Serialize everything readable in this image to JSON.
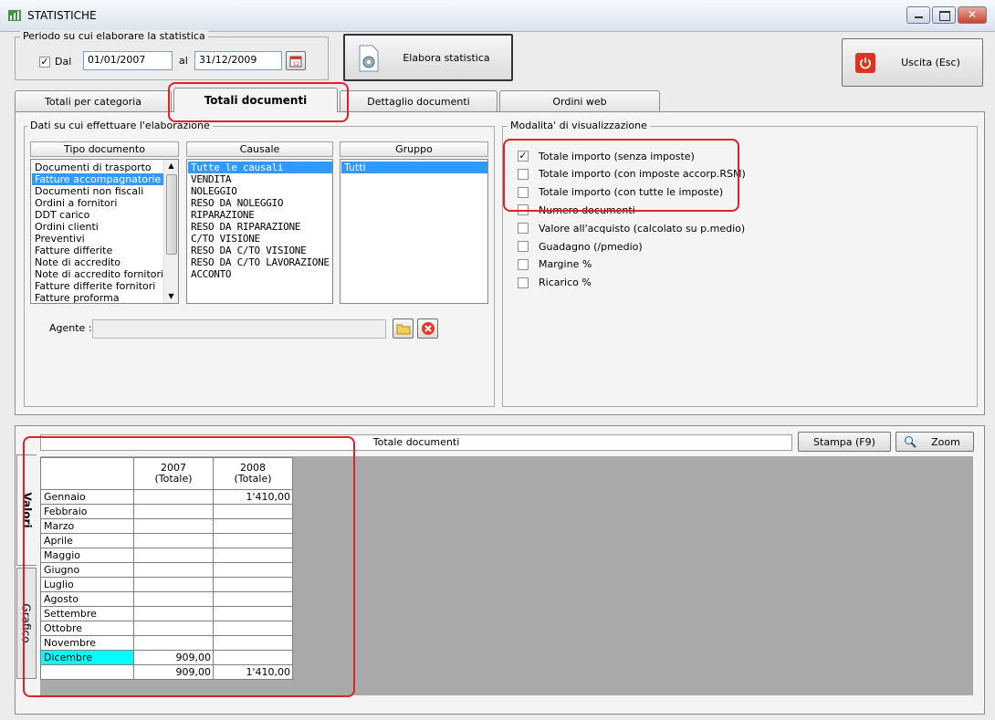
{
  "window": {
    "title": "STATISTICHE"
  },
  "period": {
    "group_label": "Periodo su cui elaborare la statistica",
    "from_label": "Dal",
    "from_checked": true,
    "from_value": "01/01/2007",
    "to_label": "al",
    "to_value": "31/12/2009"
  },
  "toolbar": {
    "process_label": "Elabora statistica",
    "exit_label": "Uscita (Esc)"
  },
  "tabs": [
    {
      "label": "Totali per categoria"
    },
    {
      "label": "Totali documenti"
    },
    {
      "label": "Dettaglio documenti"
    },
    {
      "label": "Ordini web"
    }
  ],
  "data_group": {
    "label": "Dati su cui effettuare l'elaborazione",
    "tipo_header": "Tipo documento",
    "tipo_items": [
      "Documenti di trasporto",
      "Fatture accompagnatorie",
      "Documenti non fiscali",
      "Ordini a fornitori",
      "DDT carico",
      "Ordini clienti",
      "Preventivi",
      "Fatture differite",
      "Note di accredito",
      "Note di accredito fornitori",
      "Fatture differite fornitori",
      "Fatture proforma"
    ],
    "causale_header": "Causale",
    "causale_items": [
      "Tutte le causali",
      "VENDITA",
      "NOLEGGIO",
      "RESO DA NOLEGGIO",
      "RIPARAZIONE",
      "RESO DA RIPARAZIONE",
      "C/TO VISIONE",
      "RESO DA C/TO VISIONE",
      "RESO DA C/TO LAVORAZIONE",
      "ACCONTO"
    ],
    "gruppo_header": "Gruppo",
    "gruppo_items": [
      "Tutti"
    ],
    "agente_label": "Agente :",
    "agente_value": ""
  },
  "display_group": {
    "label": "Modalita' di visualizzazione",
    "options": [
      {
        "label": "Totale importo (senza imposte)",
        "checked": true
      },
      {
        "label": "Totale importo (con imposte accorp.RSM)",
        "checked": false
      },
      {
        "label": "Totale importo (con tutte le imposte)",
        "checked": false
      },
      {
        "label": "Numero documenti",
        "checked": false
      },
      {
        "label": "Valore all'acquisto (calcolato su p.medio)",
        "checked": false
      },
      {
        "label": "Guadagno (/pmedio)",
        "checked": false
      },
      {
        "label": "Margine %",
        "checked": false
      },
      {
        "label": "Ricarico %",
        "checked": false
      }
    ]
  },
  "results": {
    "title": "Totale documenti",
    "print_label": "Stampa (F9)",
    "zoom_label": "Zoom",
    "side_tabs": [
      "Valori",
      "Grafico"
    ],
    "columns": [
      "2007\n(Totale)",
      "2008\n(Totale)"
    ],
    "rows": [
      {
        "label": "Gennaio",
        "values": [
          "",
          "1'410,00"
        ]
      },
      {
        "label": "Febbraio",
        "values": [
          "",
          ""
        ]
      },
      {
        "label": "Marzo",
        "values": [
          "",
          ""
        ]
      },
      {
        "label": "Aprile",
        "values": [
          "",
          ""
        ]
      },
      {
        "label": "Maggio",
        "values": [
          "",
          ""
        ]
      },
      {
        "label": "Giugno",
        "values": [
          "",
          ""
        ]
      },
      {
        "label": "Luglio",
        "values": [
          "",
          ""
        ]
      },
      {
        "label": "Agosto",
        "values": [
          "",
          ""
        ]
      },
      {
        "label": "Settembre",
        "values": [
          "",
          ""
        ]
      },
      {
        "label": "Ottobre",
        "values": [
          "",
          ""
        ]
      },
      {
        "label": "Novembre",
        "values": [
          "",
          ""
        ]
      },
      {
        "label": "Dicembre",
        "values": [
          "909,00",
          ""
        ]
      }
    ],
    "totals": [
      "909,00",
      "1'410,00"
    ]
  },
  "colors": {
    "selection": "#3399ff",
    "highlight": "#00ffff",
    "annotation": "#e0202a"
  }
}
